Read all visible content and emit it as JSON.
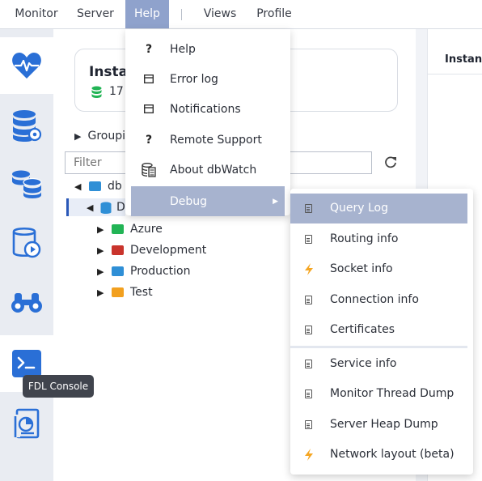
{
  "menubar": {
    "items": [
      "Monitor",
      "Server",
      "Help",
      "Views",
      "Profile"
    ],
    "active": "Help"
  },
  "instances_card": {
    "title": "Insta",
    "count": "17",
    "divider": "|"
  },
  "grouping_label": "Groupi",
  "filter": {
    "placeholder": "Filter"
  },
  "tree": {
    "root_label": "db",
    "child_label": "D",
    "groups": [
      "Azure",
      "Development",
      "Production",
      "Test"
    ]
  },
  "right_panel": {
    "tab_label": "Instanc"
  },
  "tooltip": {
    "text": "FDL Console"
  },
  "help_menu": {
    "items": [
      "Help",
      "Error log",
      "Notifications",
      "Remote Support",
      "About dbWatch",
      "Debug"
    ]
  },
  "debug_menu": {
    "items": [
      "Query Log",
      "Routing info",
      "Socket info",
      "Connection info",
      "Certificates",
      "Service info",
      "Monitor Thread Dump",
      "Server Heap Dump",
      "Network layout (beta)"
    ]
  },
  "colors": {
    "accent": "#8fa2cc",
    "highlight": "#a7b3cf",
    "icon_blue": "#2a6fd6",
    "folder_green": "#22b455",
    "folder_red": "#c9342c",
    "folder_blue": "#2f8fd6",
    "folder_orange": "#f2a01f",
    "bolt": "#f5a623"
  }
}
